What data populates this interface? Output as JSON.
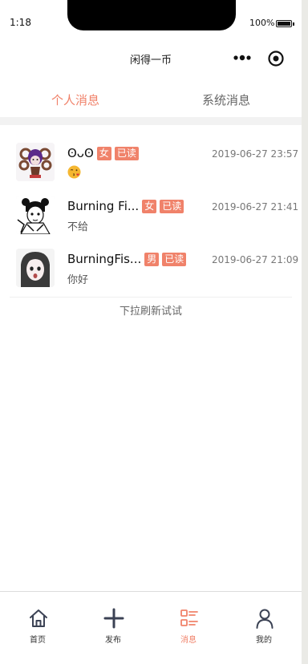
{
  "status_bar": {
    "time": "1:18",
    "battery": "100%"
  },
  "nav": {
    "title": "闲得一币"
  },
  "tabs": [
    {
      "label": "个人消息",
      "active": true
    },
    {
      "label": "系统消息",
      "active": false
    }
  ],
  "messages": [
    {
      "name": "ʘᴗʘ",
      "gender": "女",
      "read": "已读",
      "time": "2019-06-27 23:57",
      "text": "",
      "emoji": "face-blowing-kiss-icon"
    },
    {
      "name": "Burning Fi...",
      "gender": "女",
      "read": "已读",
      "time": "2019-06-27 21:41",
      "text": "不给"
    },
    {
      "name": "BurningFis...",
      "gender": "男",
      "read": "已读",
      "time": "2019-06-27 21:09",
      "text": "你好"
    }
  ],
  "pull_hint": "下拉刷新试试",
  "tab_bar": [
    {
      "label": "首页",
      "icon": "home-icon"
    },
    {
      "label": "发布",
      "icon": "plus-icon"
    },
    {
      "label": "消息",
      "icon": "message-list-icon",
      "active": true
    },
    {
      "label": "我的",
      "icon": "user-icon"
    }
  ],
  "colors": {
    "accent": "#f0826a",
    "background": "#ffffff",
    "band": "#f2f2f2"
  }
}
